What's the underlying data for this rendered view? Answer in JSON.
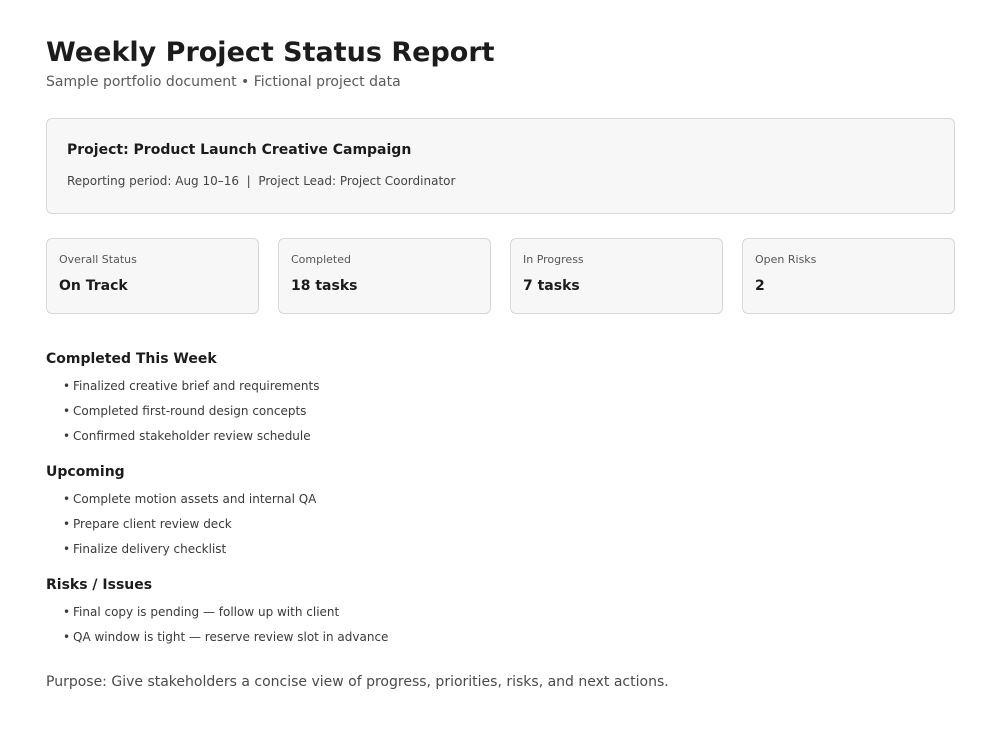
{
  "header": {
    "title": "Weekly Project Status Report",
    "subtitle": "Sample portfolio document • Fictional project data"
  },
  "project": {
    "name": "Project: Product Launch Creative Campaign",
    "meta": "Reporting period: Aug 10–16  |  Project Lead: Project Coordinator"
  },
  "cards": [
    {
      "label": "Overall Status",
      "value": "On Track"
    },
    {
      "label": "Completed",
      "value": "18 tasks"
    },
    {
      "label": "In Progress",
      "value": "7 tasks"
    },
    {
      "label": "Open Risks",
      "value": "2"
    }
  ],
  "sections": {
    "completed": {
      "heading": "Completed This Week",
      "items": [
        "Finalized creative brief and requirements",
        "Completed first-round design concepts",
        "Confirmed stakeholder review schedule"
      ]
    },
    "upcoming": {
      "heading": "Upcoming",
      "items": [
        "Complete motion assets and internal QA",
        "Prepare client review deck",
        "Finalize delivery checklist"
      ]
    },
    "risks": {
      "heading": "Risks / Issues",
      "items": [
        "Final copy is pending — follow up with client",
        "QA window is tight — reserve review slot in advance"
      ]
    }
  },
  "footer": {
    "purpose": "Purpose: Give stakeholders a concise view of progress, priorities, risks, and next actions."
  },
  "bullet_glyph": "•"
}
